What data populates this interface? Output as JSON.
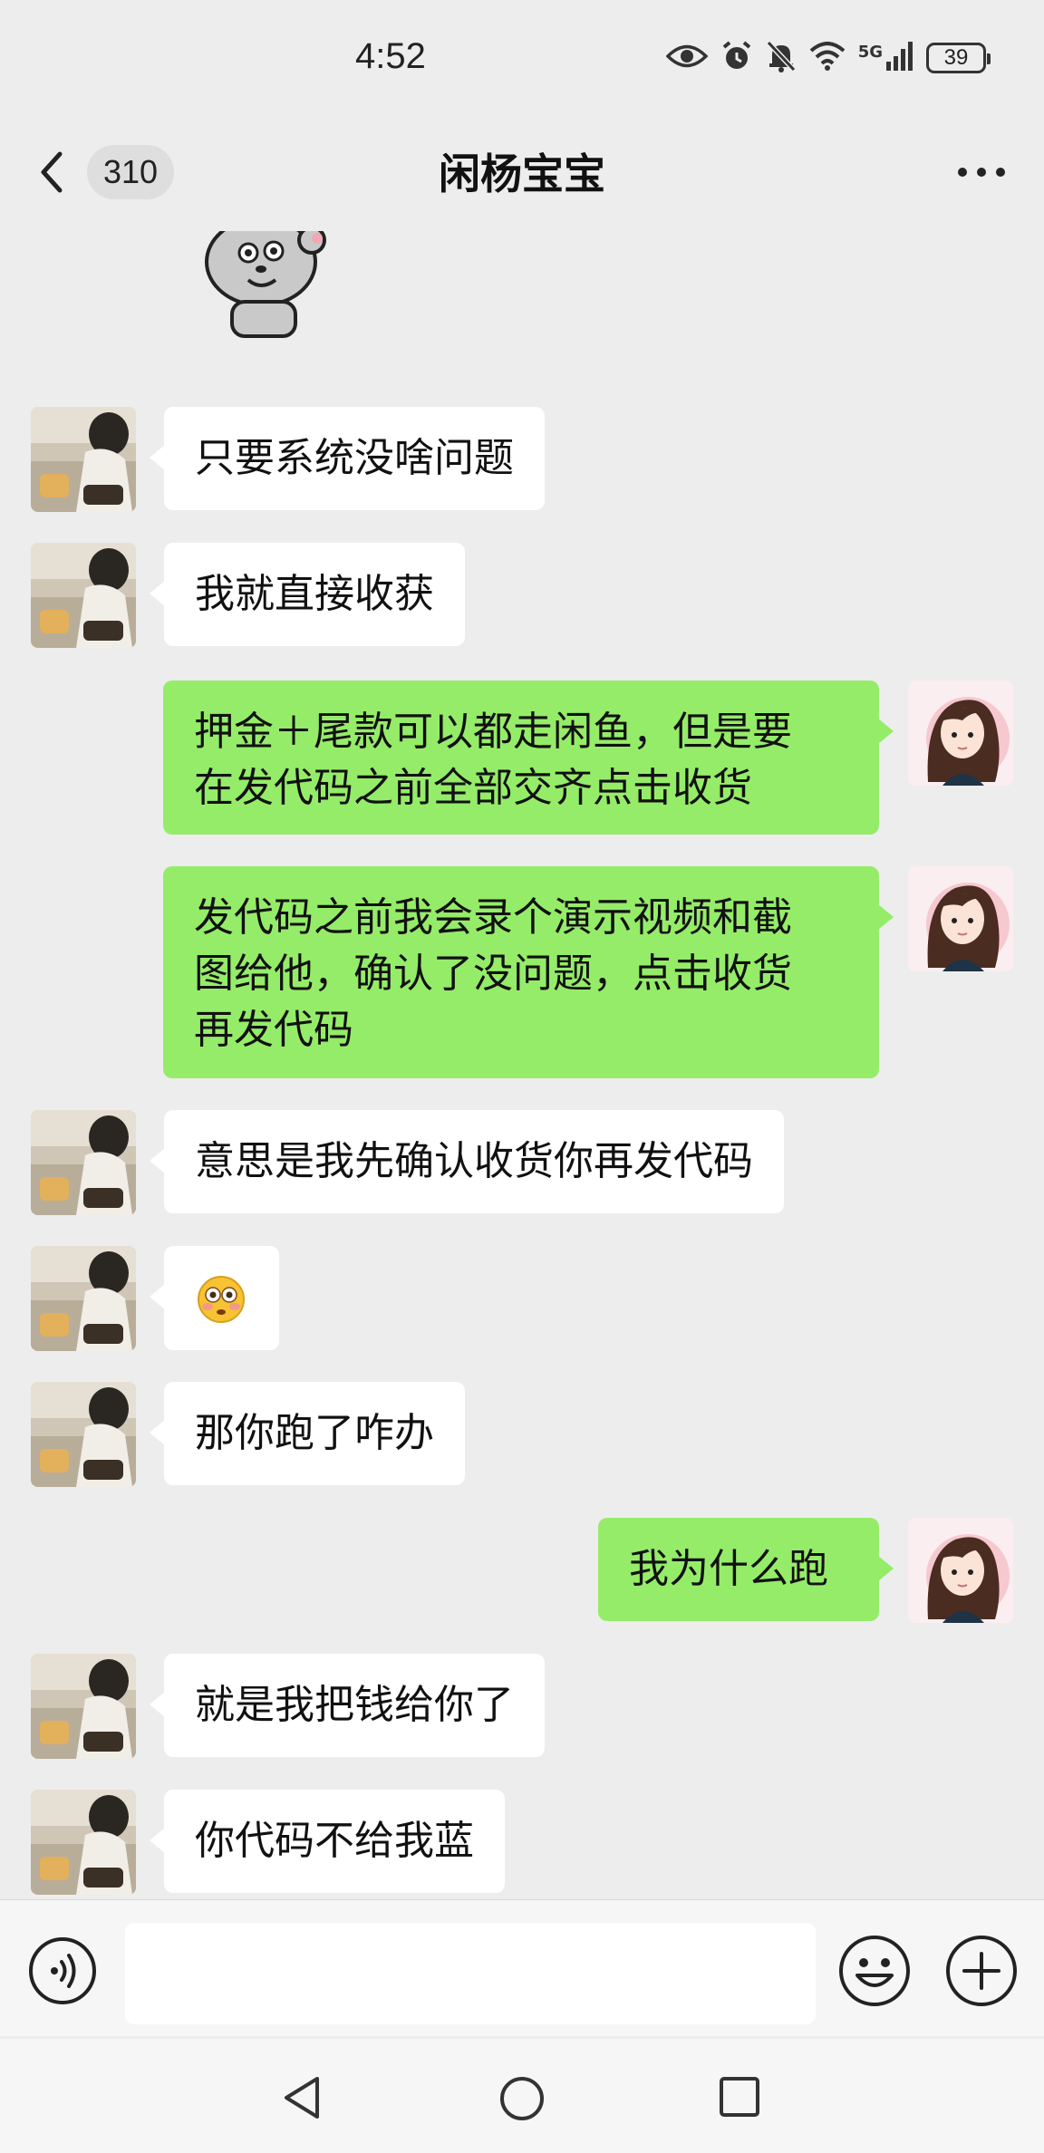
{
  "status_bar": {
    "time": "4:52",
    "network": "5G",
    "battery": "39"
  },
  "header": {
    "unread_count": "310",
    "title": "闲杨宝宝"
  },
  "messages": [
    {
      "from": "them",
      "type": "sticker",
      "text": ""
    },
    {
      "from": "them",
      "type": "text",
      "text": "只要系统没啥问题"
    },
    {
      "from": "them",
      "type": "text",
      "text": "我就直接收获"
    },
    {
      "from": "me",
      "type": "text",
      "line1": "押金＋尾款可以都走闲鱼，但是要",
      "line2": "在发代码之前全部交齐点击收货"
    },
    {
      "from": "me",
      "type": "text",
      "line1": "发代码之前我会录个演示视频和截",
      "line2": "图给他，确认了没问题，点击收货",
      "line3": "再发代码"
    },
    {
      "from": "them",
      "type": "text",
      "text": "意思是我先确认收货你再发代码"
    },
    {
      "from": "them",
      "type": "emoji",
      "text": "😳"
    },
    {
      "from": "them",
      "type": "text",
      "text": "那你跑了咋办"
    },
    {
      "from": "me",
      "type": "text",
      "text": "我为什么跑"
    },
    {
      "from": "them",
      "type": "text",
      "text": "就是我把钱给你了"
    },
    {
      "from": "them",
      "type": "text",
      "text": "你代码不给我蓝"
    }
  ],
  "input_bar": {
    "placeholder": ""
  },
  "colors": {
    "background": "#ededed",
    "outgoing_bubble": "#95ec69",
    "incoming_bubble": "#ffffff"
  }
}
